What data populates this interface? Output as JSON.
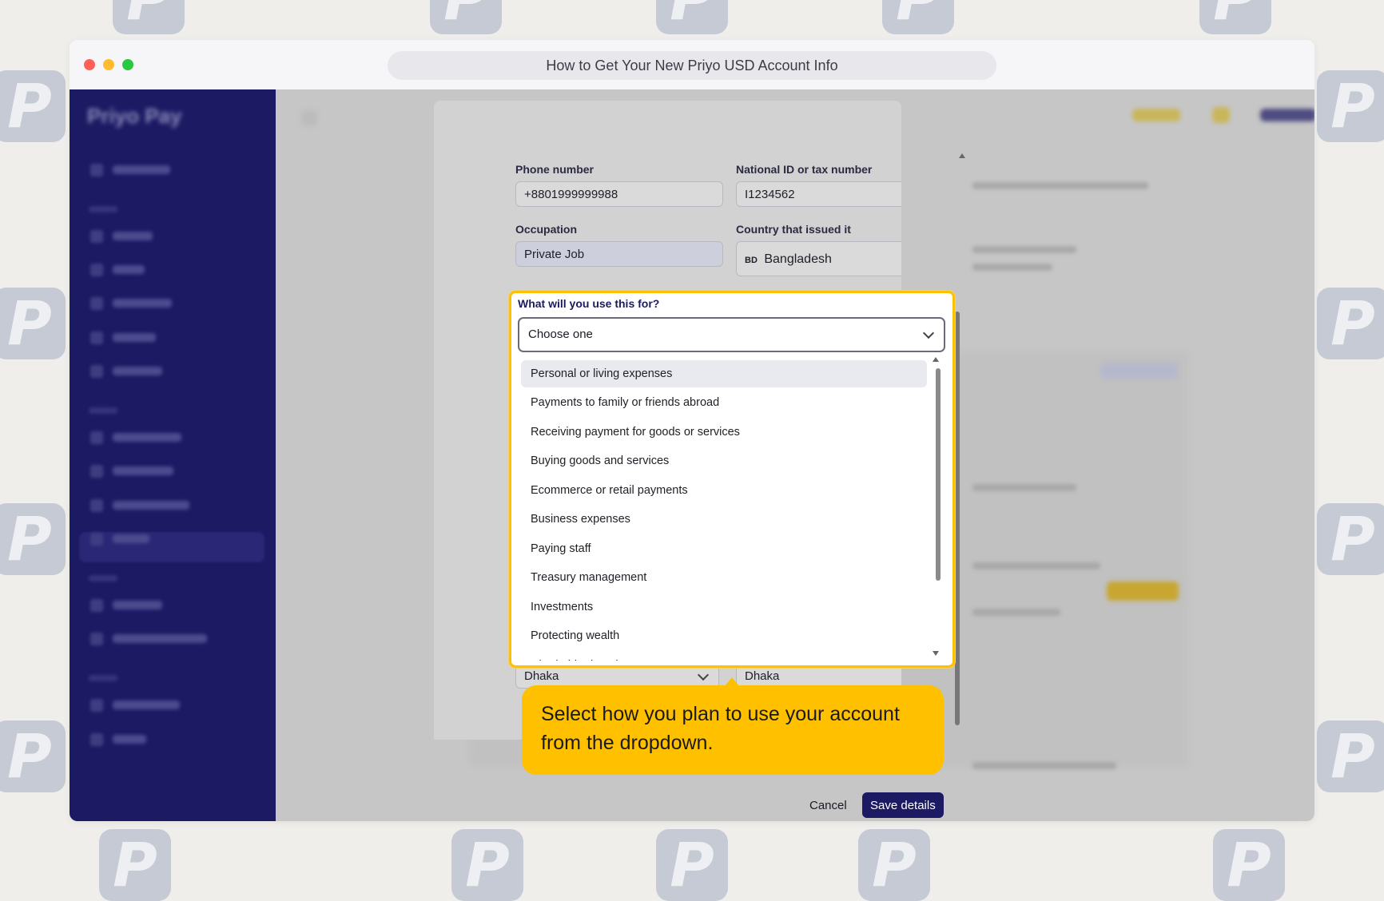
{
  "window": {
    "title": "How to Get Your New Priyo USD Account Info"
  },
  "watermark": {
    "glyph": "P"
  },
  "sidebar": {
    "logo": "Priyo Pay"
  },
  "form": {
    "phone_label": "Phone number",
    "phone_value": "+8801999999988",
    "national_id_label": "National ID or tax number",
    "national_id_value": "I1234562",
    "occupation_label": "Occupation",
    "occupation_value": "Private Job",
    "country_label": "Country that issued it",
    "country_code": "BD",
    "country_value": "Bangladesh",
    "purpose_label": "What will you use this for?",
    "purpose_placeholder": "Choose one",
    "purpose_options": [
      "Personal or living expenses",
      "Payments to family or friends abroad",
      "Receiving payment for goods or services",
      "Buying goods and services",
      "Ecommerce or retail payments",
      "Business expenses",
      "Paying staff",
      "Treasury management",
      "Investments",
      "Protecting wealth",
      "Charitable donations"
    ],
    "city_value": "Dhaka",
    "district_value": "Dhaka",
    "cancel_label": "Cancel",
    "save_label": "Save details"
  },
  "tooltip": {
    "text": "Select how you plan to use your account from the dropdown."
  },
  "colors": {
    "accent": "#ffc000",
    "brand": "#1c1a63"
  }
}
